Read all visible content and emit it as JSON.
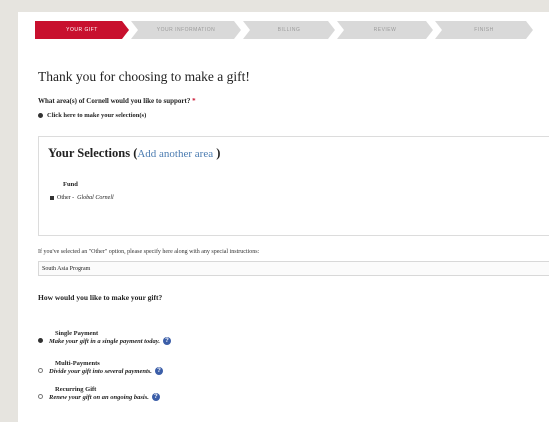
{
  "steps": [
    {
      "label": "YOUR GIFT",
      "active": true
    },
    {
      "label": "YOUR INFORMATION",
      "active": false
    },
    {
      "label": "BILLING",
      "active": false
    },
    {
      "label": "REVIEW",
      "active": false
    },
    {
      "label": "FINISH",
      "active": false
    }
  ],
  "page_title": "Thank you for choosing to make a gift!",
  "area_question": "What area(s) of Cornell would you like to support?",
  "required_marker": "*",
  "selection_link": "Click here to make your selection(s)",
  "selections": {
    "heading": "Your Selections",
    "open_paren": "(",
    "add_link": "Add another area",
    "close_paren": ")",
    "fund_label": "Fund",
    "fund_item_prefix": "Other -",
    "fund_item_name": "Global Cornell"
  },
  "instructions": {
    "label": "If you've selected an \"Other\" option, please specify here along with any special instructions:",
    "value": "South Asia Program"
  },
  "payment_question": "How would you like to make your gift?",
  "payment_options": [
    {
      "title": "Single Payment",
      "description": "Make your gift in a single payment today.",
      "selected": true
    },
    {
      "title": "Multi-Payments",
      "description": "Divide your gift into several payments.",
      "selected": false
    },
    {
      "title": "Recurring Gift",
      "description": "Renew your gift on an ongoing basis.",
      "selected": false
    }
  ],
  "help_glyph": "?",
  "colors": {
    "accent": "#c8102e",
    "link": "#4a7bb0",
    "help": "#3b5ea8",
    "inactive_step": "#d9d9d9",
    "background": "#e6e4df"
  }
}
